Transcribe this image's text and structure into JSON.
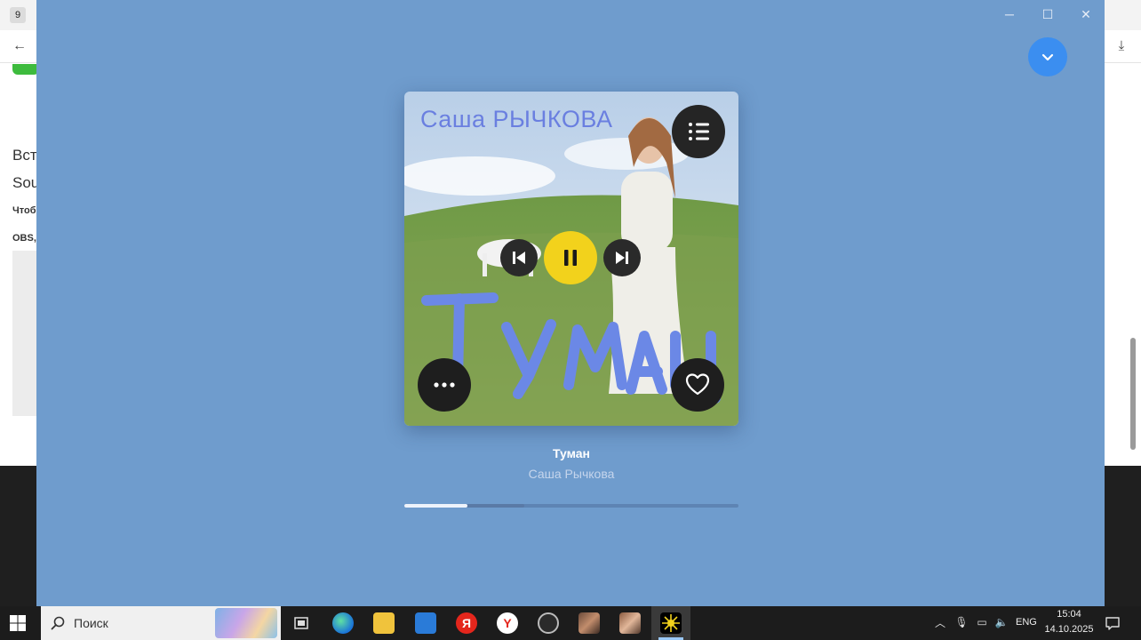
{
  "background_browser": {
    "tab_icon_label": "9",
    "text_lines": [
      "Вст",
      "Sou",
      "Чтоб",
      "OBS,"
    ]
  },
  "player": {
    "background_color": "#6f9ccd",
    "cover": {
      "artist_text": "Саша  РЫЧКОВА",
      "title_art_text": "Туман"
    },
    "track": {
      "title": "Туман",
      "artist": "Саша Рычкова"
    },
    "progress": {
      "played_fraction": 0.19,
      "buffered_fraction": 0.36
    },
    "controls": {
      "queue_icon": "list-icon",
      "prev_icon": "skip-previous-icon",
      "pause_icon": "pause-icon",
      "next_icon": "skip-next-icon",
      "more_icon": "more-horizontal-icon",
      "like_icon": "heart-icon",
      "collapse_icon": "chevron-down-icon"
    },
    "colors": {
      "pause_button": "#f2d21c",
      "collapse_button": "#3b8ef0"
    }
  },
  "taskbar": {
    "search_placeholder": "Поиск",
    "language": "ENG",
    "time": "15:04",
    "date": "14.10.2025",
    "pinned_apps": [
      "task-view",
      "edge",
      "file-explorer",
      "store",
      "yandex",
      "yandex-browser",
      "obs",
      "photo-app-1",
      "photo-app-2",
      "active-app"
    ]
  }
}
